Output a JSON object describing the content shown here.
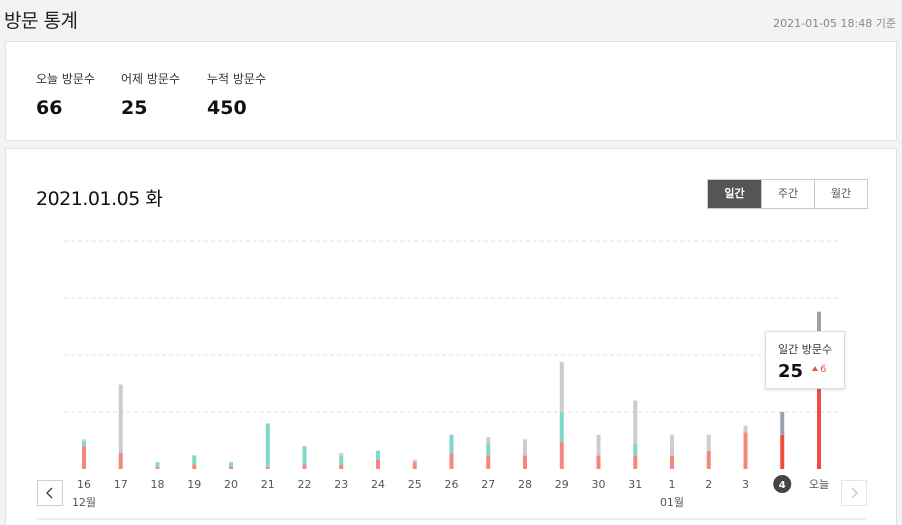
{
  "page": {
    "title": "방문 통계",
    "timestamp": "2021-01-05 18:48 기준"
  },
  "summary": [
    {
      "label": "오늘 방문수",
      "value": "66"
    },
    {
      "label": "어제 방문수",
      "value": "25"
    },
    {
      "label": "누적 방문수",
      "value": "450"
    }
  ],
  "chart_header": {
    "date": "2021.01.05 화",
    "tabs": [
      {
        "label": "일간",
        "active": true
      },
      {
        "label": "주간",
        "active": false
      },
      {
        "label": "월간",
        "active": false
      }
    ]
  },
  "tooltip": {
    "label": "일간 방문수",
    "value": "25",
    "delta": "6",
    "delta_direction": "up"
  },
  "colors": {
    "segment_red": "#f2887e",
    "segment_teal": "#7fd9c9",
    "segment_gray": "#c9cdd1",
    "highlight_red": "#ef4e3e",
    "highlight_gray": "#9aa3ad",
    "grid": "#e2e2e2"
  },
  "chart_data": {
    "type": "bar",
    "stacked": true,
    "ylim": [
      0,
      100
    ],
    "categories": [
      "16",
      "17",
      "18",
      "19",
      "20",
      "21",
      "22",
      "23",
      "24",
      "25",
      "26",
      "27",
      "28",
      "29",
      "30",
      "31",
      "1",
      "2",
      "3",
      "4",
      "오늘"
    ],
    "month_labels": [
      {
        "index": 0,
        "label": "12월"
      },
      {
        "index": 16,
        "label": "01월"
      }
    ],
    "highlighted_index": 19,
    "today_index": 20,
    "series": [
      {
        "values": [
          10,
          7,
          1,
          2,
          1,
          1,
          2,
          2,
          4,
          3,
          7,
          6,
          6,
          12,
          6,
          6,
          6,
          8,
          16,
          15,
          54
        ]
      },
      {
        "values": [
          2,
          0,
          2,
          4,
          2,
          19,
          8,
          4,
          4,
          0,
          8,
          5,
          0,
          13,
          0,
          5,
          0,
          0,
          0,
          0,
          2
        ]
      },
      {
        "values": [
          1,
          30,
          0,
          0,
          0,
          0,
          0,
          1,
          0,
          1,
          0,
          3,
          7,
          22,
          9,
          19,
          9,
          7,
          3,
          10,
          13
        ]
      }
    ]
  }
}
